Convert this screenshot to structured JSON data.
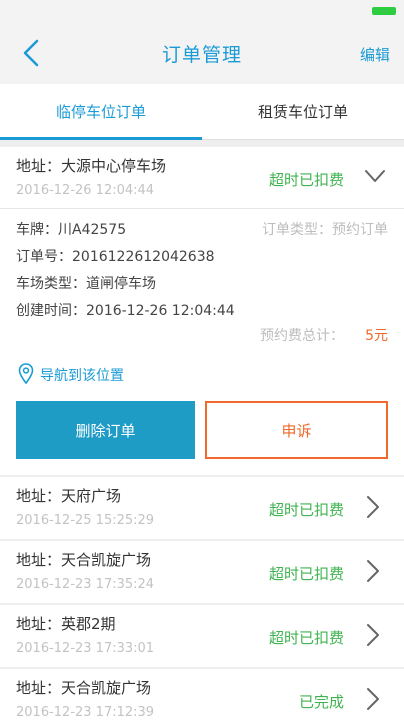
{
  "nav": {
    "title": "订单管理",
    "edit_label": "编辑"
  },
  "tabs": [
    {
      "label": "临停车位订单",
      "active": true
    },
    {
      "label": "租赁车位订单",
      "active": false
    }
  ],
  "expanded_order": {
    "address": "地址：大源中心停车场",
    "date": "2016-12-26 12:04:44",
    "status": "超时已扣费",
    "plate": "车牌：川A42575",
    "order_type": "订单类型：预约订单",
    "order_no": "订单号：2016122612042638",
    "lot_type": "车场类型：道闸停车场",
    "created": "创建时间：2016-12-26 12:04:44",
    "fee_label": "预约费总计：",
    "fee_value": "5元",
    "navigate_label": "导航到该位置",
    "delete_label": "删除订单",
    "appeal_label": "申诉"
  },
  "orders": [
    {
      "address": "地址：天府广场",
      "date": "2016-12-25 15:25:29",
      "status": "超时已扣费"
    },
    {
      "address": "地址：天合凯旋广场",
      "date": "2016-12-23 17:35:24",
      "status": "超时已扣费"
    },
    {
      "address": "地址：英郡2期",
      "date": "2016-12-23 17:33:01",
      "status": "超时已扣费"
    },
    {
      "address": "地址：天合凯旋广场",
      "date": "2016-12-23 17:12:39",
      "status": "已完成"
    }
  ],
  "colors": {
    "accent": "#1a9bd6",
    "status_green": "#3fb34f",
    "orange": "#ef6a2a"
  }
}
